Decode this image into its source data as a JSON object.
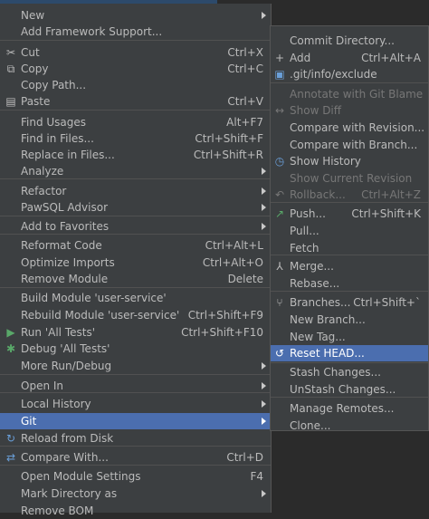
{
  "main_menu": [
    {
      "label": "New",
      "shortcut": "",
      "submenu": true,
      "icon": "",
      "icon_name": ""
    },
    {
      "label": "Add Framework Support...",
      "shortcut": "",
      "submenu": false,
      "icon": "",
      "icon_name": ""
    },
    {
      "label": "Cut",
      "shortcut": "Ctrl+X",
      "submenu": false,
      "icon": "✂",
      "icon_name": "cut-icon"
    },
    {
      "label": "Copy",
      "shortcut": "Ctrl+C",
      "submenu": false,
      "icon": "⧉",
      "icon_name": "copy-icon"
    },
    {
      "label": "Copy Path...",
      "shortcut": "",
      "submenu": false,
      "icon": "",
      "icon_name": ""
    },
    {
      "label": "Paste",
      "shortcut": "Ctrl+V",
      "submenu": false,
      "icon": "▤",
      "icon_name": "paste-icon"
    },
    {
      "label": "Find Usages",
      "shortcut": "Alt+F7",
      "submenu": false,
      "icon": "",
      "icon_name": ""
    },
    {
      "label": "Find in Files...",
      "shortcut": "Ctrl+Shift+F",
      "submenu": false,
      "icon": "",
      "icon_name": ""
    },
    {
      "label": "Replace in Files...",
      "shortcut": "Ctrl+Shift+R",
      "submenu": false,
      "icon": "",
      "icon_name": ""
    },
    {
      "label": "Analyze",
      "shortcut": "",
      "submenu": true,
      "icon": "",
      "icon_name": ""
    },
    {
      "label": "Refactor",
      "shortcut": "",
      "submenu": true,
      "icon": "",
      "icon_name": ""
    },
    {
      "label": "PawSQL Advisor",
      "shortcut": "",
      "submenu": true,
      "icon": "",
      "icon_name": ""
    },
    {
      "label": "Add to Favorites",
      "shortcut": "",
      "submenu": true,
      "icon": "",
      "icon_name": ""
    },
    {
      "label": "Reformat Code",
      "shortcut": "Ctrl+Alt+L",
      "submenu": false,
      "icon": "",
      "icon_name": ""
    },
    {
      "label": "Optimize Imports",
      "shortcut": "Ctrl+Alt+O",
      "submenu": false,
      "icon": "",
      "icon_name": ""
    },
    {
      "label": "Remove Module",
      "shortcut": "Delete",
      "submenu": false,
      "icon": "",
      "icon_name": ""
    },
    {
      "label": "Build Module 'user-service'",
      "shortcut": "",
      "submenu": false,
      "icon": "",
      "icon_name": ""
    },
    {
      "label": "Rebuild Module 'user-service'",
      "shortcut": "Ctrl+Shift+F9",
      "submenu": false,
      "icon": "",
      "icon_name": ""
    },
    {
      "label": "Run 'All Tests'",
      "shortcut": "Ctrl+Shift+F10",
      "submenu": false,
      "icon": "▶",
      "icon_name": "run-icon"
    },
    {
      "label": "Debug 'All Tests'",
      "shortcut": "",
      "submenu": false,
      "icon": "✱",
      "icon_name": "debug-icon"
    },
    {
      "label": "More Run/Debug",
      "shortcut": "",
      "submenu": true,
      "icon": "",
      "icon_name": ""
    },
    {
      "label": "Open In",
      "shortcut": "",
      "submenu": true,
      "icon": "",
      "icon_name": ""
    },
    {
      "label": "Local History",
      "shortcut": "",
      "submenu": true,
      "icon": "",
      "icon_name": ""
    },
    {
      "label": "Git",
      "shortcut": "",
      "submenu": true,
      "icon": "",
      "icon_name": ""
    },
    {
      "label": "Reload from Disk",
      "shortcut": "",
      "submenu": false,
      "icon": "↻",
      "icon_name": "reload-icon"
    },
    {
      "label": "Compare With...",
      "shortcut": "Ctrl+D",
      "submenu": false,
      "icon": "⇄",
      "icon_name": "compare-icon"
    },
    {
      "label": "Open Module Settings",
      "shortcut": "F4",
      "submenu": false,
      "icon": "",
      "icon_name": ""
    },
    {
      "label": "Mark Directory as",
      "shortcut": "",
      "submenu": true,
      "icon": "",
      "icon_name": ""
    },
    {
      "label": "Remove BOM",
      "shortcut": "",
      "submenu": false,
      "icon": "",
      "icon_name": ""
    }
  ],
  "git_menu": [
    {
      "label": "Commit Directory...",
      "shortcut": "",
      "submenu": false,
      "icon": "",
      "icon_name": ""
    },
    {
      "label": "Add",
      "shortcut": "Ctrl+Alt+A",
      "submenu": false,
      "icon": "+",
      "icon_name": "add-icon"
    },
    {
      "label": ".git/info/exclude",
      "shortcut": "",
      "submenu": false,
      "icon": "▣",
      "icon_name": "git-file-icon"
    },
    {
      "label": "Annotate with Git Blame",
      "shortcut": "",
      "submenu": false,
      "icon": "",
      "icon_name": ""
    },
    {
      "label": "Show Diff",
      "shortcut": "",
      "submenu": false,
      "icon": "↔",
      "icon_name": "diff-icon"
    },
    {
      "label": "Compare with Revision...",
      "shortcut": "",
      "submenu": false,
      "icon": "",
      "icon_name": ""
    },
    {
      "label": "Compare with Branch...",
      "shortcut": "",
      "submenu": false,
      "icon": "",
      "icon_name": ""
    },
    {
      "label": "Show History",
      "shortcut": "",
      "submenu": false,
      "icon": "◷",
      "icon_name": "history-icon"
    },
    {
      "label": "Show Current Revision",
      "shortcut": "",
      "submenu": false,
      "icon": "",
      "icon_name": ""
    },
    {
      "label": "Rollback...",
      "shortcut": "Ctrl+Alt+Z",
      "submenu": false,
      "icon": "↶",
      "icon_name": "rollback-icon"
    },
    {
      "label": "Push...",
      "shortcut": "Ctrl+Shift+K",
      "submenu": false,
      "icon": "↗",
      "icon_name": "push-icon"
    },
    {
      "label": "Pull...",
      "shortcut": "",
      "submenu": false,
      "icon": "",
      "icon_name": ""
    },
    {
      "label": "Fetch",
      "shortcut": "",
      "submenu": false,
      "icon": "",
      "icon_name": ""
    },
    {
      "label": "Merge...",
      "shortcut": "",
      "submenu": false,
      "icon": "⅄",
      "icon_name": "merge-icon"
    },
    {
      "label": "Rebase...",
      "shortcut": "",
      "submenu": false,
      "icon": "",
      "icon_name": ""
    },
    {
      "label": "Branches...",
      "shortcut": "Ctrl+Shift+`",
      "submenu": false,
      "icon": "⑂",
      "icon_name": "branch-icon"
    },
    {
      "label": "New Branch...",
      "shortcut": "",
      "submenu": false,
      "icon": "",
      "icon_name": ""
    },
    {
      "label": "New Tag...",
      "shortcut": "",
      "submenu": false,
      "icon": "",
      "icon_name": ""
    },
    {
      "label": "Reset HEAD...",
      "shortcut": "",
      "submenu": false,
      "icon": "↺",
      "icon_name": "reset-icon"
    },
    {
      "label": "Stash Changes...",
      "shortcut": "",
      "submenu": false,
      "icon": "",
      "icon_name": ""
    },
    {
      "label": "UnStash Changes...",
      "shortcut": "",
      "submenu": false,
      "icon": "",
      "icon_name": ""
    },
    {
      "label": "Manage Remotes...",
      "shortcut": "",
      "submenu": false,
      "icon": "",
      "icon_name": ""
    },
    {
      "label": "Clone...",
      "shortcut": "",
      "submenu": false,
      "icon": "",
      "icon_name": ""
    }
  ],
  "state": {
    "main_selected": "Git",
    "git_selected": "Reset HEAD...",
    "git_disabled": [
      "Annotate with Git Blame",
      "Show Diff",
      "Show Current Revision",
      "Rollback..."
    ]
  },
  "colors": {
    "menu_bg": "#3c3f41",
    "selection": "#4b6eaf",
    "text": "#bbbbbb",
    "disabled_text": "#777777",
    "run_green": "#59a869",
    "accent_blue": "#6a9fd9"
  }
}
